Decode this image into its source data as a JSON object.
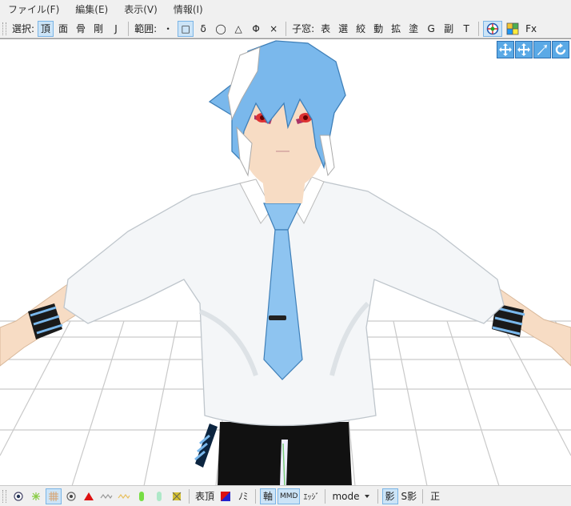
{
  "menu": {
    "file": "ファイル(F)",
    "edit": "編集(E)",
    "view": "表示(V)",
    "info": "情報(I)"
  },
  "toolbar": {
    "select_label": "選択:",
    "select_buttons": [
      "頂",
      "面",
      "骨",
      "剛",
      "J"
    ],
    "range_label": "範囲:",
    "range_buttons": [
      "・",
      "□",
      "δ",
      "◯",
      "△",
      "Φ",
      "×"
    ],
    "child_label": "子窓:",
    "child_buttons": [
      "表",
      "選",
      "絞",
      "動",
      "拡",
      "塗",
      "G",
      "副",
      "T"
    ],
    "fx_label": "Fx"
  },
  "status": {
    "vertex_label": "表頂",
    "material_label": "ﾉﾐ",
    "axis_label": "軸",
    "mmd_label": "MMD",
    "edge_label": "ｴｯｼﾞ",
    "mode_label": "mode",
    "shadow_label": "影",
    "sshadow_label": "S影",
    "ortho_label": "正"
  },
  "colors": {
    "hair": "#7ab8ec",
    "tie": "#8ec4f0",
    "skin": "#f7dcc4",
    "shirt": "#f4f6f8",
    "accent": "#cce4f7"
  }
}
